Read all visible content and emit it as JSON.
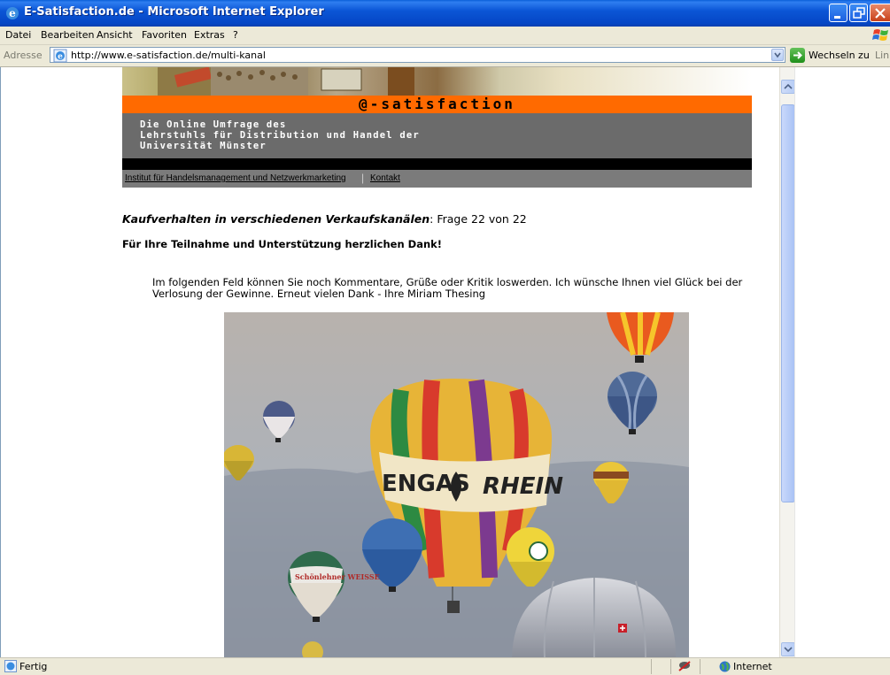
{
  "window": {
    "title": "E-Satisfaction.de - Microsoft Internet Explorer"
  },
  "menu": {
    "items": [
      "Datei",
      "Bearbeiten",
      "Ansicht",
      "Favoriten",
      "Extras",
      "?"
    ]
  },
  "address": {
    "label": "Adresse",
    "url": "http://www.e-satisfaction.de/multi-kanal",
    "go_label": "Wechseln zu",
    "links_label": "Link"
  },
  "banner": {
    "logo_text": "@-satisfaction",
    "tagline": "Die Online Umfrage des\nLehrstuhls für Distribution und Handel der\nUniversität Münster",
    "link_institut": "Institut für Handelsmanagement und Netzwerkmarketing",
    "link_kontakt": "Kontakt"
  },
  "content": {
    "question_title": "Kaufverhalten in verschiedenen Verkaufskanälen",
    "question_counter": ": Frage 22 von 22",
    "thanks": "Für Ihre Teilnahme und Unterstützung herzlichen Dank!",
    "paragraph": "Im folgenden Feld können Sie noch Kommentare, Grüße oder Kritik loswerden. Ich wünsche Ihnen viel Glück bei der Verlosung der Gewinne. Erneut vielen Dank - Ihre Miriam Thesing",
    "photo_texts": {
      "balloon_text_left": "ENGAS",
      "balloon_text_right": "RHEIN",
      "small_balloon_text": "Schönlehner WEISSE"
    }
  },
  "status": {
    "text": "Fertig",
    "zone": "Internet"
  },
  "colors": {
    "banner_orange": "#ff6a00",
    "banner_gray": "#6b6b6b",
    "titlebar_blue": "#0a5fd8"
  }
}
